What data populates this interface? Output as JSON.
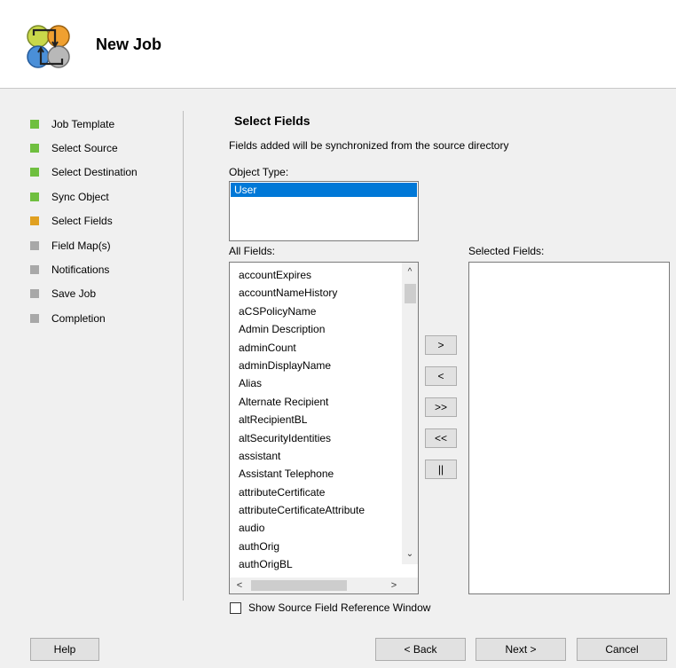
{
  "header": {
    "title": "New Job",
    "logo_icon": "sync-circles-logo"
  },
  "steps": [
    {
      "label": "Job Template",
      "status": "done",
      "color": "#6fbf3f"
    },
    {
      "label": "Select Source",
      "status": "done",
      "color": "#6fbf3f"
    },
    {
      "label": "Select Destination",
      "status": "done",
      "color": "#6fbf3f"
    },
    {
      "label": "Sync Object",
      "status": "done",
      "color": "#6fbf3f"
    },
    {
      "label": "Select Fields",
      "status": "current",
      "color": "#e0a020"
    },
    {
      "label": "Field Map(s)",
      "status": "pending",
      "color": "#a8a8a8"
    },
    {
      "label": "Notifications",
      "status": "pending",
      "color": "#a8a8a8"
    },
    {
      "label": "Save Job",
      "status": "pending",
      "color": "#a8a8a8"
    },
    {
      "label": "Completion",
      "status": "pending",
      "color": "#a8a8a8"
    }
  ],
  "main": {
    "title": "Select Fields",
    "description": "Fields added will be synchronized from the source directory",
    "object_type_label": "Object Type:",
    "object_types": [
      "User"
    ],
    "all_fields_label": "All Fields:",
    "selected_fields_label": "Selected Fields:",
    "all_fields": [
      "accountExpires",
      "accountNameHistory",
      "aCSPolicyName",
      "Admin Description",
      "adminCount",
      "adminDisplayName",
      "Alias",
      "Alternate Recipient",
      "altRecipientBL",
      "altSecurityIdentities",
      "assistant",
      "Assistant Telephone",
      "attributeCertificate",
      "attributeCertificateAttribute",
      "audio",
      "authOrig",
      "authOrigBL"
    ],
    "selected_fields": [],
    "move_buttons": {
      "add": ">",
      "remove": "<",
      "add_all": ">>",
      "remove_all": "<<",
      "pause": "||"
    },
    "show_reference_label": "Show Source Field Reference Window",
    "show_reference_checked": false
  },
  "footer": {
    "help": "Help",
    "back": "< Back",
    "next": "Next >",
    "cancel": "Cancel"
  }
}
